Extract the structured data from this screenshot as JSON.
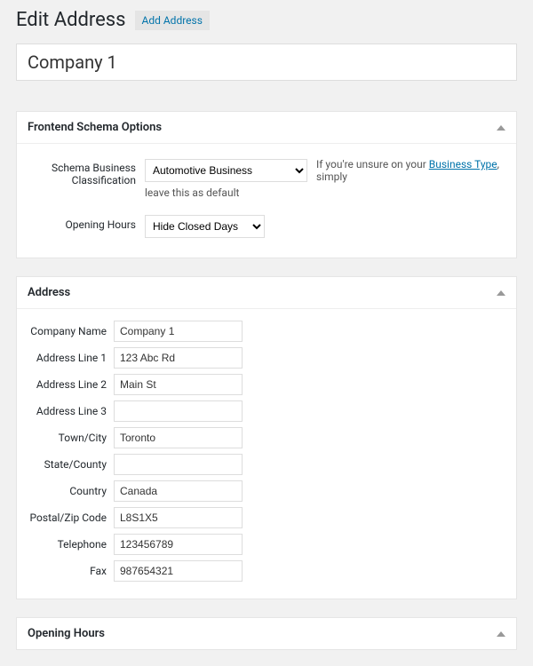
{
  "header": {
    "page_title": "Edit Address",
    "add_button": "Add Address"
  },
  "company_title": "Company 1",
  "schema_box": {
    "heading": "Frontend Schema Options",
    "classification_label": "Schema Business Classification",
    "classification_value": "Automotive Business",
    "classification_hint_pre": "If you're unsure on your ",
    "classification_hint_link": "Business Type",
    "classification_hint_post": ", simply",
    "classification_hint_below": "leave this as default",
    "opening_hours_label": "Opening Hours",
    "opening_hours_value": "Hide Closed Days"
  },
  "address_box": {
    "heading": "Address",
    "fields": {
      "company_name": {
        "label": "Company Name",
        "value": "Company 1"
      },
      "line1": {
        "label": "Address Line 1",
        "value": "123 Abc Rd"
      },
      "line2": {
        "label": "Address Line 2",
        "value": "Main St"
      },
      "line3": {
        "label": "Address Line 3",
        "value": ""
      },
      "town": {
        "label": "Town/City",
        "value": "Toronto"
      },
      "state": {
        "label": "State/County",
        "value": ""
      },
      "country": {
        "label": "Country",
        "value": "Canada"
      },
      "postal": {
        "label": "Postal/Zip Code",
        "value": "L8S1X5"
      },
      "tel": {
        "label": "Telephone",
        "value": "123456789"
      },
      "fax": {
        "label": "Fax",
        "value": "987654321"
      }
    }
  },
  "opening_hours_box": {
    "heading": "Opening Hours"
  }
}
